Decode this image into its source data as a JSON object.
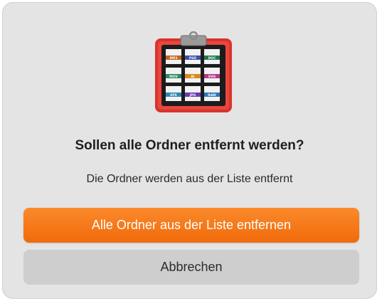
{
  "dialog": {
    "icon": "clipboard-file-types-icon",
    "title": "Sollen alle Ordner entfernt werden?",
    "message": "Die Ordner werden aus der Liste entfernt",
    "primary_label": "Alle Ordner aus der Liste entfernen",
    "secondary_label": "Abbrechen"
  },
  "icon_tiles": [
    "MP3",
    "PSD",
    "DOC",
    "MOV",
    "AI",
    "SVG",
    "EPS",
    "JPG",
    "RAW"
  ],
  "colors": {
    "accent": "#f47a1a",
    "dialog_bg": "#e4e4e4",
    "secondary_button": "#cecece",
    "icon_red": "#e53a35"
  }
}
